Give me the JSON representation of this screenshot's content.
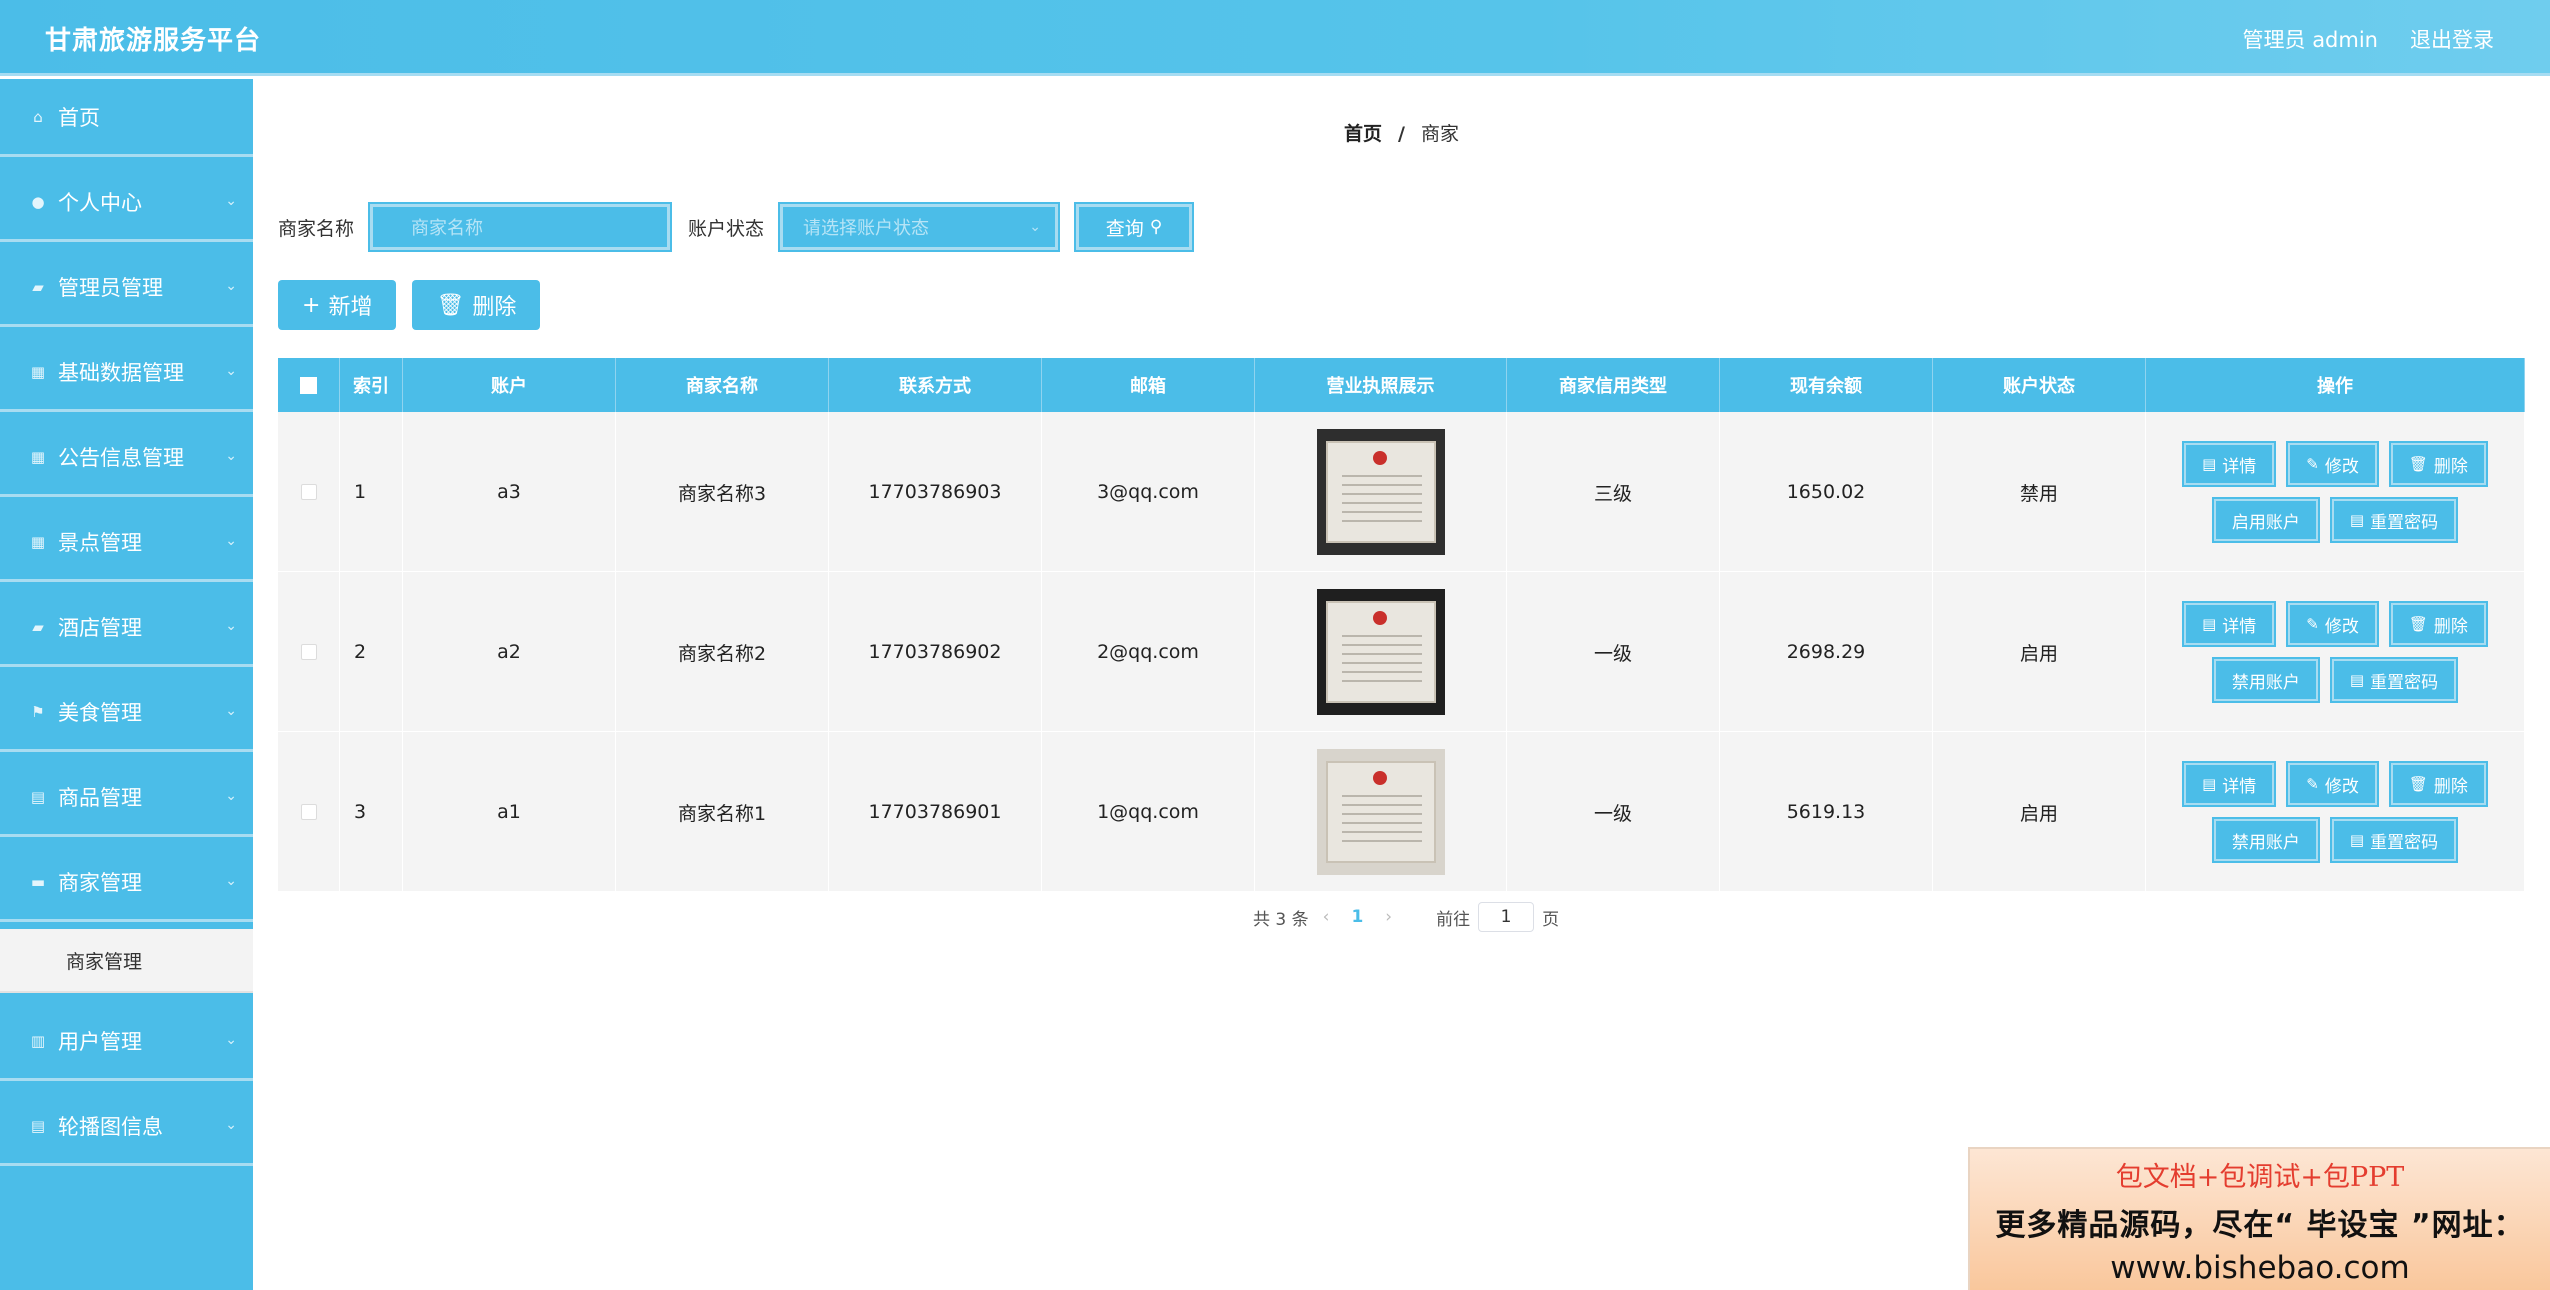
{
  "header": {
    "brand": "甘肃旅游服务平台",
    "admin": "管理员 admin",
    "logout": "退出登录"
  },
  "sidebar": {
    "items": [
      {
        "label": "首页",
        "icon": "home-icon",
        "glyph": "⌂",
        "has_children": false
      },
      {
        "label": "个人中心",
        "icon": "user-icon",
        "glyph": "●",
        "has_children": true
      },
      {
        "label": "管理员管理",
        "icon": "briefcase-icon",
        "glyph": "▰",
        "has_children": true
      },
      {
        "label": "基础数据管理",
        "icon": "grid-icon",
        "glyph": "▦",
        "has_children": true
      },
      {
        "label": "公告信息管理",
        "icon": "grid-icon",
        "glyph": "▦",
        "has_children": true
      },
      {
        "label": "景点管理",
        "icon": "grid-icon",
        "glyph": "▦",
        "has_children": true
      },
      {
        "label": "酒店管理",
        "icon": "briefcase-icon",
        "glyph": "▰",
        "has_children": true
      },
      {
        "label": "美食管理",
        "icon": "flag-icon",
        "glyph": "⚑",
        "has_children": true
      },
      {
        "label": "商品管理",
        "icon": "clipboard-icon",
        "glyph": "▤",
        "has_children": true
      },
      {
        "label": "商家管理",
        "icon": "store-icon",
        "glyph": "▬",
        "has_children": true
      },
      {
        "label": "用户管理",
        "icon": "user-card-icon",
        "glyph": "▥",
        "has_children": true
      },
      {
        "label": "轮播图信息",
        "icon": "clipboard-icon",
        "glyph": "▤",
        "has_children": true
      }
    ],
    "submenu_label": "商家管理"
  },
  "breadcrumb": {
    "home": "首页",
    "sep": "/",
    "current": "商家"
  },
  "search": {
    "name_label": "商家名称",
    "name_placeholder": "商家名称",
    "status_label": "账户状态",
    "status_placeholder": "请选择账户状态",
    "query_label": "查询"
  },
  "actions": {
    "add_label": "新增",
    "delete_label": "删除"
  },
  "table": {
    "headers": [
      "索引",
      "账户",
      "商家名称",
      "联系方式",
      "邮箱",
      "营业执照展示",
      "商家信用类型",
      "现有余额",
      "账户状态",
      "操作"
    ],
    "rows": [
      {
        "index": "1",
        "account": "a3",
        "name": "商家名称3",
        "phone": "17703786903",
        "email": "3@qq.com",
        "credit": "三级",
        "balance": "1650.02",
        "status": "禁用",
        "toggle_label": "启用账户"
      },
      {
        "index": "2",
        "account": "a2",
        "name": "商家名称2",
        "phone": "17703786902",
        "email": "2@qq.com",
        "credit": "一级",
        "balance": "2698.29",
        "status": "启用",
        "toggle_label": "禁用账户"
      },
      {
        "index": "3",
        "account": "a1",
        "name": "商家名称1",
        "phone": "17703786901",
        "email": "1@qq.com",
        "credit": "一级",
        "balance": "5619.13",
        "status": "启用",
        "toggle_label": "禁用账户"
      }
    ],
    "op_labels": {
      "detail": "详情",
      "edit": "修改",
      "delete": "删除",
      "reset": "重置密码"
    }
  },
  "pager": {
    "total": "共 3 条",
    "page": "1",
    "goto": "前往",
    "goto_value": "1",
    "unit": "页"
  },
  "banner": {
    "line1": "包文档+包调试+包PPT",
    "line2": "更多精品源码，尽在“ 毕设宝 ”网址：",
    "line3": "www.bishebao.com"
  },
  "colors": {
    "primary": "#4bbde8",
    "border": "#a8dcf1",
    "row_bg": "#f4f4f4"
  }
}
